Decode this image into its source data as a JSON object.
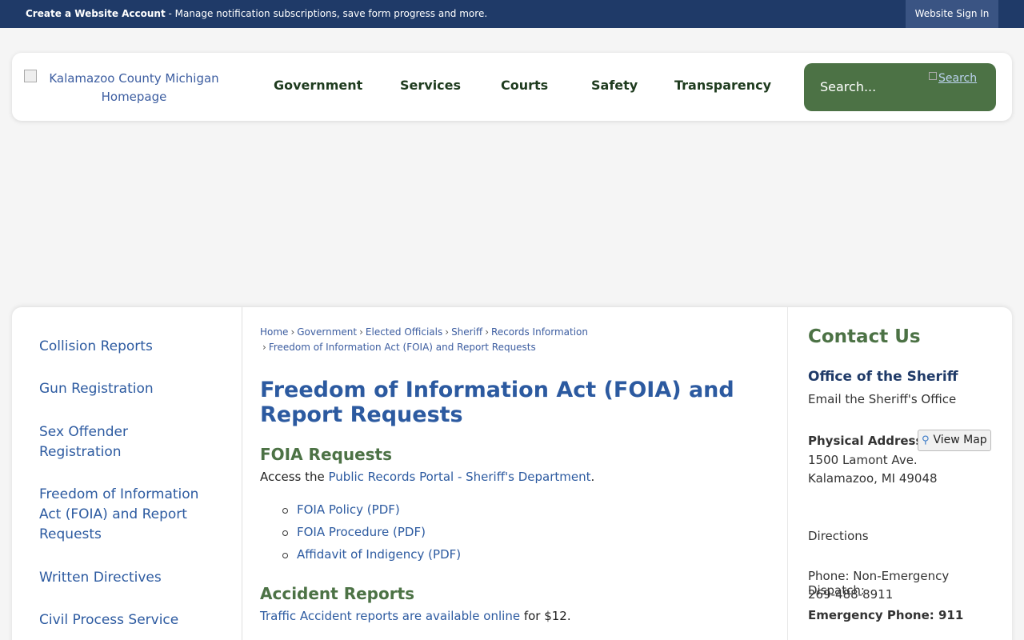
{
  "topbar": {
    "create_account": "Create a Website Account",
    "message": " - Manage notification subscriptions, save form progress and more.",
    "sign_in": "Website Sign In",
    "bg_color": "#1f3a68"
  },
  "header": {
    "logo_alt": "Kalamazoo County Michigan Homepage",
    "nav": [
      "Government",
      "Services",
      "Courts",
      "Safety",
      "Transparency"
    ],
    "search_placeholder": "Search...",
    "search_button_alt": "Search",
    "accent_color": "#4c7245"
  },
  "sidebar": {
    "items": [
      "Collision Reports",
      "Gun Registration",
      "Sex Offender Registration",
      "Freedom of Information Act (FOIA) and Report Requests",
      "Written Directives",
      "Civil Process Service"
    ]
  },
  "breadcrumb": {
    "items": [
      "Home",
      "Government",
      "Elected Officials",
      "Sheriff",
      "Records Information",
      "Freedom of Information Act (FOIA) and Report Requests"
    ]
  },
  "main": {
    "title": "Freedom of Information Act (FOIA) and Report Requests",
    "foia_heading": "FOIA Requests",
    "foia_intro_prefix": "Access the ",
    "foia_portal_link": "Public Records Portal - Sheriff's Department",
    "foia_intro_suffix": ".",
    "documents": [
      "FOIA Policy (PDF)",
      "FOIA Procedure (PDF)",
      "Affidavit of Indigency (PDF)"
    ],
    "accident_heading": "Accident Reports",
    "accident_link": "Traffic Accident reports are available online",
    "accident_suffix": " for $12."
  },
  "contact": {
    "title": "Contact Us",
    "office": "Office of the Sheriff",
    "email": "Email the Sheriff's Office",
    "address_label": "Physical Address",
    "view_map": "View Map",
    "address_line1": "1500 Lamont Ave.",
    "address_line2": "Kalamazoo, MI 49048",
    "directions": "Directions",
    "phone_line1": "Phone: Non-Emergency Dispatch:",
    "phone_line2": "269-488-8911",
    "emergency": "Emergency Phone: 911"
  }
}
